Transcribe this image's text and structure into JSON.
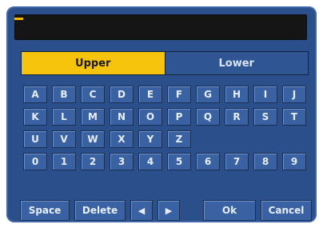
{
  "input": {
    "value": ""
  },
  "tabs": {
    "upper": "Upper",
    "lower": "Lower"
  },
  "keys": {
    "row1": [
      "A",
      "B",
      "C",
      "D",
      "E",
      "F",
      "G",
      "H",
      "I",
      "J"
    ],
    "row2": [
      "K",
      "L",
      "M",
      "N",
      "O",
      "P",
      "Q",
      "R",
      "S",
      "T"
    ],
    "row3": [
      "U",
      "V",
      "W",
      "X",
      "Y",
      "Z"
    ],
    "row4": [
      "0",
      "1",
      "2",
      "3",
      "4",
      "5",
      "6",
      "7",
      "8",
      "9"
    ]
  },
  "buttons": {
    "space": "Space",
    "delete": "Delete",
    "left": "◀",
    "right": "▶",
    "ok": "Ok",
    "cancel": "Cancel"
  },
  "colors": {
    "panel": "#2b4f8a",
    "active_tab": "#f6c40d",
    "key": "#3a61a2",
    "cursor": "#f2b800"
  }
}
